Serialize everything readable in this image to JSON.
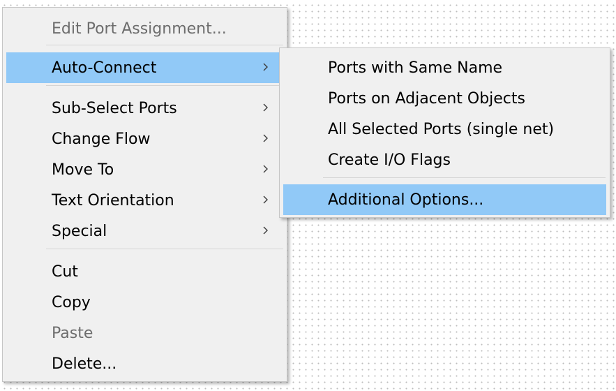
{
  "context_menu": {
    "items": [
      {
        "label": "Edit Port Assignment...",
        "disabled": true
      },
      {
        "label": "Auto-Connect",
        "submenu": true,
        "highlighted": true
      },
      {
        "label": "Sub-Select Ports",
        "submenu": true
      },
      {
        "label": "Change Flow",
        "submenu": true
      },
      {
        "label": "Move To",
        "submenu": true
      },
      {
        "label": "Text Orientation",
        "submenu": true
      },
      {
        "label": "Special",
        "submenu": true
      },
      {
        "label": "Cut"
      },
      {
        "label": "Copy"
      },
      {
        "label": "Paste",
        "disabled": true
      },
      {
        "label": "Delete..."
      }
    ]
  },
  "auto_connect_submenu": {
    "items": [
      {
        "label": "Ports with Same Name"
      },
      {
        "label": "Ports on Adjacent Objects"
      },
      {
        "label": "All Selected Ports (single net)"
      },
      {
        "label": "Create I/O Flags"
      },
      {
        "label": "Additional Options...",
        "highlighted": true
      }
    ]
  },
  "colors": {
    "highlight": "#91c9f7",
    "menu_background": "#f0f0f0",
    "disabled_text": "#6d6d6d",
    "canvas_grid_dot": "#bdbdbd"
  },
  "icons": {
    "submenu_arrow": "chevron-right-icon"
  }
}
